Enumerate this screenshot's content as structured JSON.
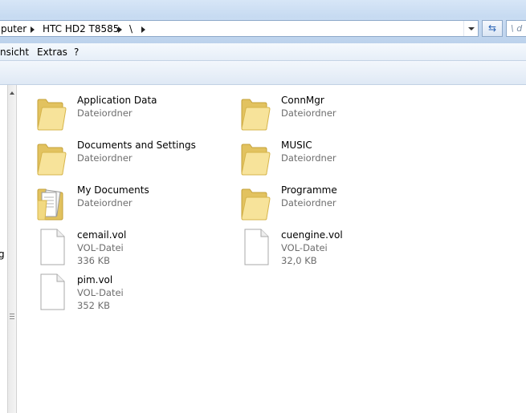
{
  "address_bar": {
    "crumbs": [
      "puter",
      "HTC HD2 T8585",
      "\\"
    ],
    "search_placeholder": "\\ d"
  },
  "menu": {
    "items": [
      "nsicht",
      "Extras",
      "?"
    ]
  },
  "navpane": {
    "fragment": "g"
  },
  "items": [
    {
      "name": "Application Data",
      "type": "Dateiordner",
      "icon": "folder-icon"
    },
    {
      "name": "ConnMgr",
      "type": "Dateiordner",
      "icon": "folder-icon"
    },
    {
      "name": "Documents and Settings",
      "type": "Dateiordner",
      "icon": "folder-icon"
    },
    {
      "name": "MUSIC",
      "type": "Dateiordner",
      "icon": "folder-icon"
    },
    {
      "name": "My Documents",
      "type": "Dateiordner",
      "icon": "folder-documents-icon"
    },
    {
      "name": "Programme",
      "type": "Dateiordner",
      "icon": "folder-icon"
    },
    {
      "name": "cemail.vol",
      "type": "VOL-Datei",
      "size": "336 KB",
      "icon": "file-icon"
    },
    {
      "name": "cuengine.vol",
      "type": "VOL-Datei",
      "size": "32,0 KB",
      "icon": "file-icon"
    },
    {
      "name": "pim.vol",
      "type": "VOL-Datei",
      "size": "352 KB",
      "icon": "file-icon"
    }
  ]
}
